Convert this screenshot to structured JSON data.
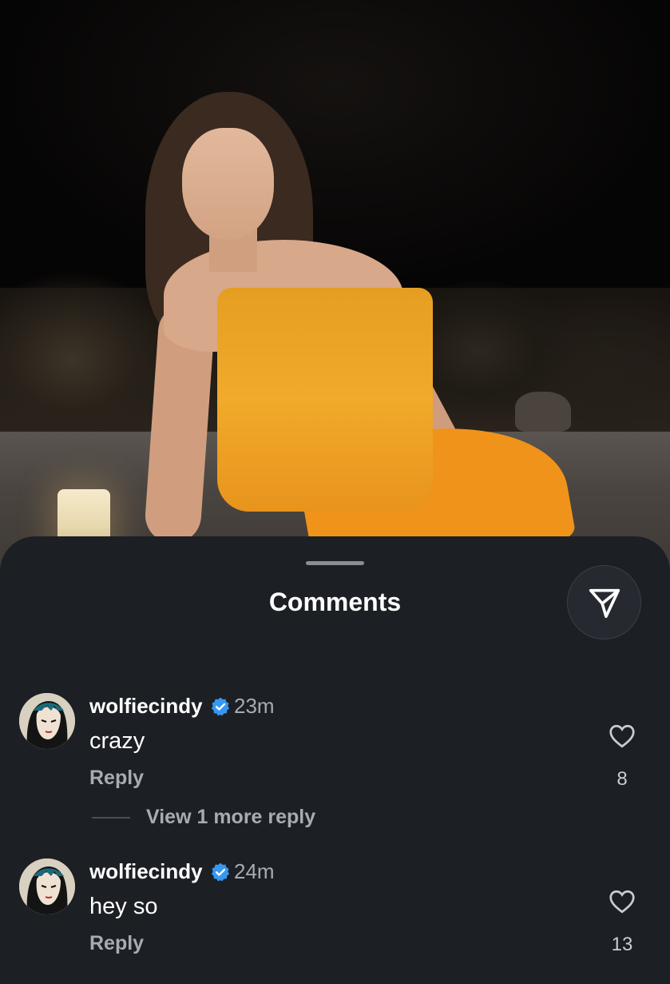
{
  "sheet": {
    "title": "Comments"
  },
  "comments": [
    {
      "username": "wolfiecindy",
      "verified": true,
      "time": "23m",
      "text": "crazy",
      "reply_label": "Reply",
      "likes": "8",
      "view_more": "View 1 more reply"
    },
    {
      "username": "wolfiecindy",
      "verified": true,
      "time": "24m",
      "text": "hey so",
      "reply_label": "Reply",
      "likes": "13"
    }
  ],
  "colors": {
    "sheet_bg": "#1c1f24",
    "verified_badge": "#3897f0",
    "dress": "#f1aa2a"
  },
  "icons": {
    "share": "paper-plane-icon",
    "like": "heart-icon",
    "verified": "verified-badge-icon"
  }
}
